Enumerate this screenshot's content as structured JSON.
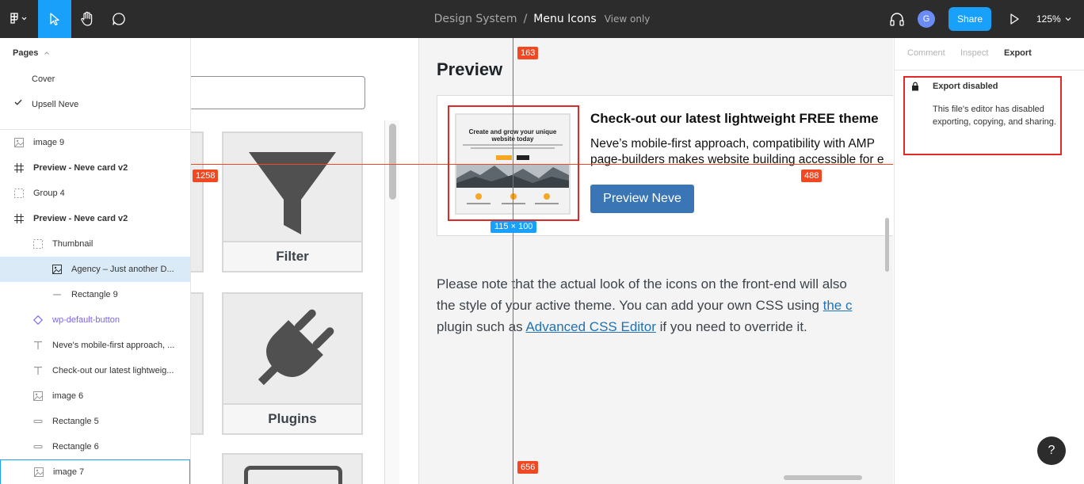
{
  "toolbar": {
    "project_name": "Design System",
    "separator": "/",
    "file_name": "Menu Icons",
    "view_only": "View only",
    "avatar_initial": "G",
    "share_label": "Share",
    "zoom": "125%"
  },
  "pages": {
    "header": "Pages",
    "items": [
      "Cover",
      "Upsell Neve"
    ],
    "current": "Upsell Neve"
  },
  "layers": [
    {
      "name": "image 9",
      "icon": "image-icon"
    },
    {
      "name": "Preview - Neve card v2",
      "icon": "frame-icon"
    },
    {
      "name": "Group 4",
      "icon": "group-icon"
    },
    {
      "name": "Preview - Neve card v2",
      "icon": "frame-icon"
    },
    {
      "name": "Thumbnail",
      "icon": "group-icon"
    },
    {
      "name": "Agency – Just another D...",
      "icon": "image-icon"
    },
    {
      "name": "Rectangle 9",
      "icon": "line-icon"
    },
    {
      "name": "wp-default-button",
      "icon": "component-icon"
    },
    {
      "name": "Neve's mobile-first approach, ...",
      "icon": "text-icon"
    },
    {
      "name": "Check-out our latest lightweig...",
      "icon": "text-icon"
    },
    {
      "name": "image 6",
      "icon": "image-icon"
    },
    {
      "name": "Rectangle 5",
      "icon": "rectangle-icon"
    },
    {
      "name": "Rectangle 6",
      "icon": "rectangle-icon"
    },
    {
      "name": "image 7",
      "icon": "image-icon"
    }
  ],
  "canvas": {
    "tiles": [
      "Filter",
      "Plugins"
    ],
    "preview_heading": "Preview",
    "thumbnail_title": "Create and grow your unique website today",
    "card_headline": "Check-out our latest lightweight FREE theme",
    "card_body_line1": "Neve’s mobile-first approach, compatibility with AMP",
    "card_body_line2": "page-builders makes website building accessible for e",
    "card_button": "Preview Neve",
    "note_line1": "Please note that the actual look of the icons on the front-end will also",
    "note_line2_a": "the style of your active theme. You can add your own CSS using ",
    "note_line2_link": "the c",
    "note_line3_a": "plugin such as ",
    "note_line3_link": "Advanced CSS Editor",
    "note_line3_b": " if you need to override it."
  },
  "measurements": {
    "top": "163",
    "left": "1258",
    "right": "488",
    "bottom": "656",
    "selection_size": "115 × 100"
  },
  "right_panel": {
    "tabs": [
      "Comment",
      "Inspect",
      "Export"
    ],
    "active_tab": "Export",
    "export_title": "Export disabled",
    "export_description": "This file's editor has disabled exporting, copying, and sharing."
  },
  "help_label": "?",
  "colors": {
    "toolbar_bg": "#2c2c2c",
    "accent_blue": "#18a0fb",
    "measure_red": "#f24822",
    "neve_button": "#3a76b5"
  }
}
